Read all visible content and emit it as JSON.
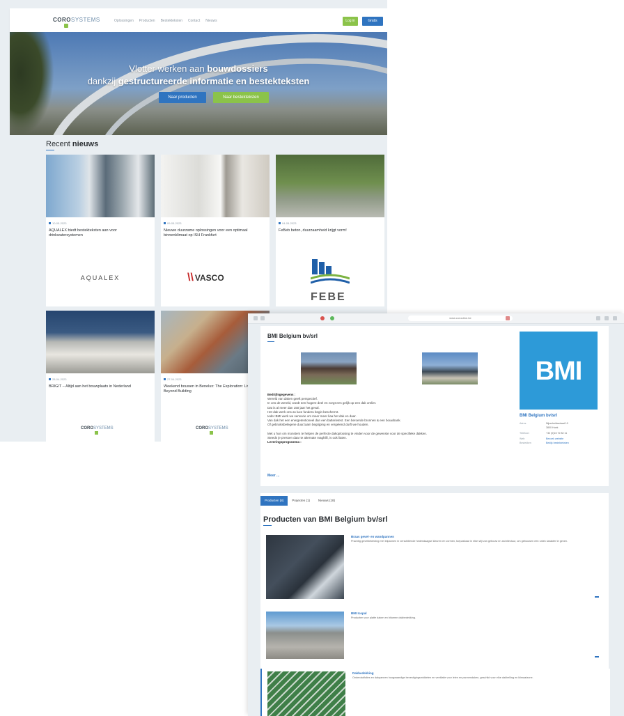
{
  "home": {
    "brand": {
      "bold": "CORO",
      "thin": "SYSTEMS"
    },
    "nav": [
      "Oplossingen",
      "Producten",
      "Bestekteksten",
      "Contact",
      "Nieuws"
    ],
    "top_buttons": {
      "login": "Log in",
      "register": "Gratis"
    },
    "hero": {
      "line1_normal": "Vlotter werken aan ",
      "line1_bold": "bouwdossiers",
      "line2_normal": "dankzij ",
      "line2_bold": "gestructureerde informatie en bestekteksten",
      "cta_products": "Naar producten",
      "cta_specs": "Naar bestekteksten"
    },
    "news_title_normal": "Recent ",
    "news_title_bold": "nieuws",
    "cards": [
      {
        "date": "10-05-2023",
        "title": "AQUALEX biedt bestekteksten aan voor drinkwatersystemen",
        "brand": "AQUALEX"
      },
      {
        "date": "09-05-2023",
        "title": "Nieuwe duurzame oplossingen voor een optimaal binnenklimaat op ISH Frankfurt",
        "brand": "VASCO"
      },
      {
        "date": "04-05-2023",
        "title": "FeBeb beton, duurzaamheid krijgt vorm!",
        "brand": "FEBE"
      },
      {
        "date": "28-04-2023",
        "title": "BRIGIT – Altijd aan het bouwplaats in Nederland",
        "brand_bold": "CORO",
        "brand_thin": "SYSTEMS"
      },
      {
        "date": "27-04-2023",
        "title": "Weekend bouwen in Benelux: The Exploration: Living Beyond Building",
        "brand_bold": "CORO",
        "brand_thin": "SYSTEMS"
      }
    ]
  },
  "detail": {
    "url": "www.coroutine.be",
    "company": "BMI Belgium bv/srl",
    "logo_text": "BMI",
    "about_label": "Bedrijfsgegevens :",
    "about_lines": [
      "Wereld van daken geeft perspectief.",
      "In ons de wereld, wordt een hogere deel en zorgt een gelijk op een dak omliet.",
      "Dat is al meer dan 150 jaar het geval.",
      "Het dak werk ons as luxe funderu begin beschermt.",
      "Ieder BMI werk we sensorie om meer meer liaa het dak en daar.",
      "Van dak het een energetentioneel dan een batterietest. Een beroerde bronnen & een bouwbank.",
      "Of gebruiksbelegene duurzaam begrijping en vergelend durft we houden.",
      "",
      "Met u hun om monsters te helpen de perfecte dakoplossing te vinden voor de gewenste voor de specifieke dakken.",
      "Steeds je pressen daar te alternate maghilll, is ook liaten."
    ],
    "delivery_label": "Leveringsprogramma :",
    "more": "Meer ...",
    "sidebar": {
      "title": "BMI Belgium bv/srl",
      "rows": [
        {
          "label": "Adres",
          "value": "Nijverheidsstraat 10"
        },
        {
          "label": "",
          "value": "3800 Hoek"
        },
        {
          "label": "Telefoon",
          "value": "+32 (0)15 72 82 11"
        },
        {
          "label": "Web",
          "value": "Bezoek website",
          "link": true
        },
        {
          "label": "Bestekken",
          "value": "Bekijk bestekteksten",
          "link": true
        }
      ]
    },
    "tabs": [
      "Producten (8)",
      "Projecten (1)",
      "Nieuws (18)"
    ],
    "products_title": "Producten van BMI Belgium bv/srl",
    "products": [
      {
        "name": "Braas gevel- en wandpannen",
        "desc": "Prachtig gevelbekleding met leipannen in verschillende hedendaagse kleuren en vormen, toepasbaar in elke stijl van gebouw en architectuur, om gebouwen een uniek karakter te geven."
      },
      {
        "name": "BMI Icopal",
        "desc": "Producten voor platte daken en bitumen dakbedekking."
      },
      {
        "name": "Dakbedekking",
        "desc": "Onderdakfolies en dakpannen hoogwaardige bevestigingsmiddelen en ventilatie voor leien en pannendaken, geschikt voor elke dakhelling en klimaatzone."
      }
    ]
  }
}
